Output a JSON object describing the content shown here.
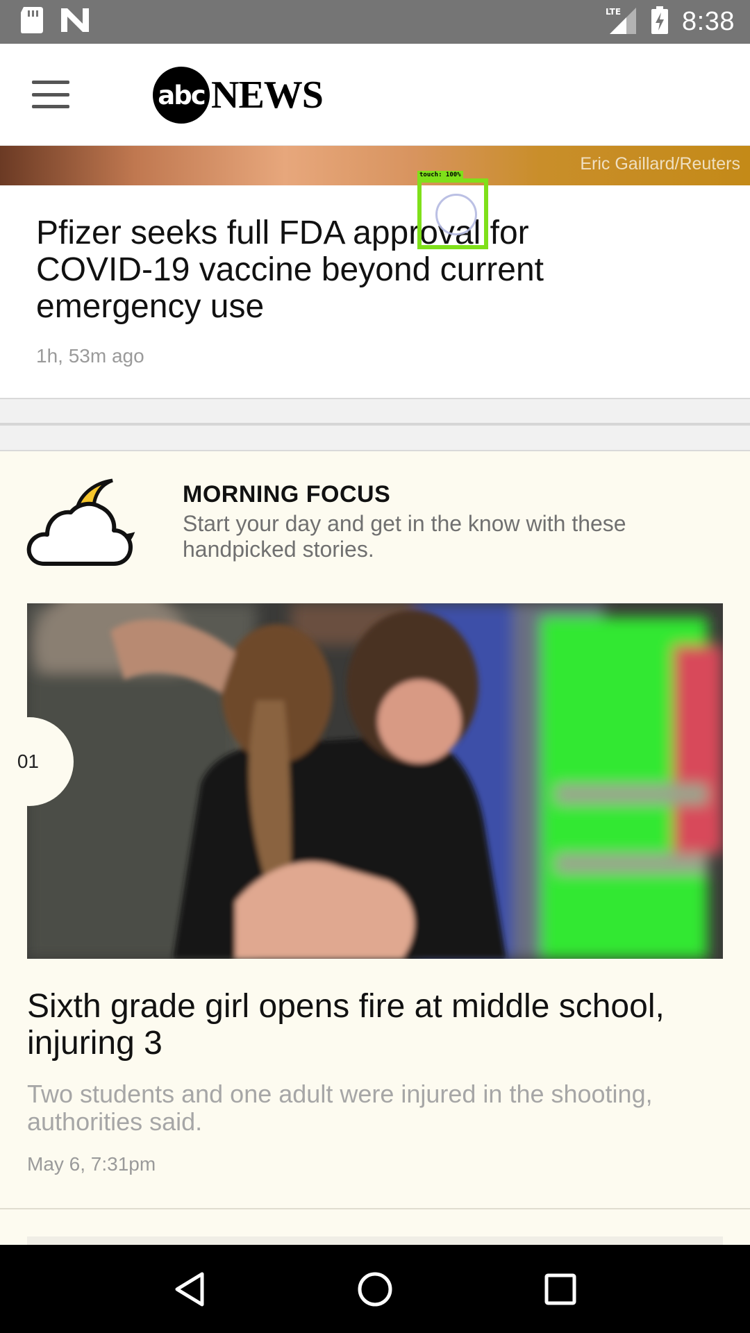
{
  "status_bar": {
    "time": "8:38",
    "network": "LTE",
    "icons": [
      "sd-card-icon",
      "n-notification-icon",
      "lte-signal-icon",
      "battery-charging-icon"
    ]
  },
  "app_bar": {
    "logo_circle": "abc",
    "logo_text": "NEWS",
    "menu_icon": "hamburger-menu-icon"
  },
  "top_story": {
    "photo_credit": "Eric Gaillard/Reuters",
    "headline": "Pfizer seeks full FDA approval for COVID-19 vaccine beyond current emergency use",
    "time": "1h, 53m ago"
  },
  "morning_focus": {
    "title": "MORNING FOCUS",
    "description": "Start your day and get in the know with these handpicked stories.",
    "icon": "cloud-moon-icon",
    "moon_color": "#f6c62c",
    "story": {
      "rank": "01",
      "headline": "Sixth grade girl opens fire at middle school, injuring 3",
      "summary": "Two students and one adult were injured in the shooting, authorities said.",
      "time": "May 6, 7:31pm"
    }
  },
  "touch_overlay": {
    "label": "touch: 100%",
    "color": "#7fe01a"
  },
  "nav_bar": {
    "icons": [
      "back-icon",
      "home-icon",
      "recents-icon"
    ]
  }
}
